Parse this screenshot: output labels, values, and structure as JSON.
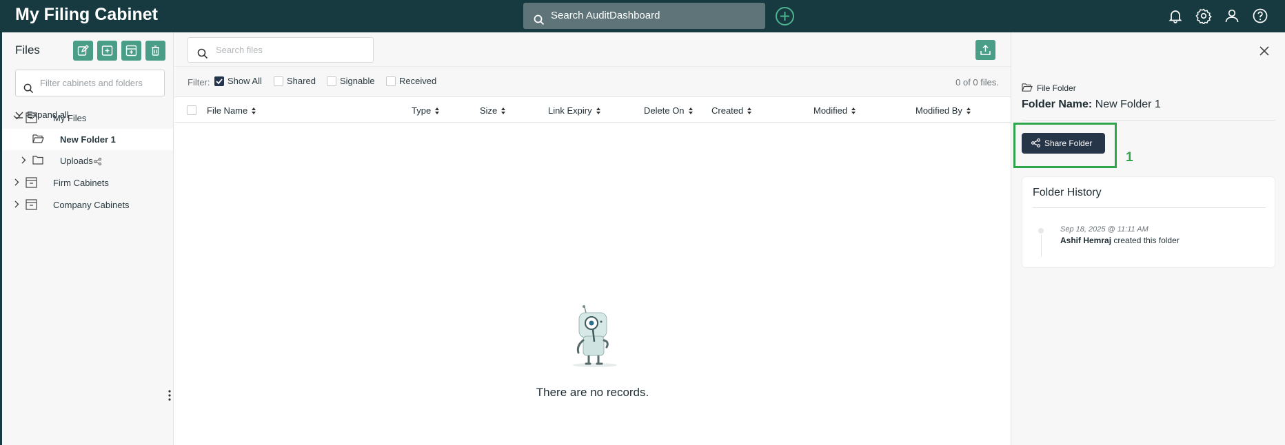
{
  "header": {
    "app_title": "My Filing Cabinet",
    "search_placeholder": "Search AuditDashboard",
    "icons": [
      "add-icon",
      "bell-icon",
      "gear-icon",
      "user-icon",
      "help-icon"
    ]
  },
  "sidebar": {
    "title": "Files",
    "action_icons": [
      "edit-icon",
      "new-folder-icon",
      "archive-icon",
      "trash-icon"
    ],
    "filter_placeholder": "Filter cabinets and folders",
    "expand_all_label": "Expand all",
    "tree": [
      {
        "label": "My Files",
        "level": 0,
        "expanded": true,
        "icon": "cabinet-icon"
      },
      {
        "label": "New Folder 1",
        "level": 1,
        "selected": true,
        "icon": "folder-open-icon"
      },
      {
        "label": "Uploads",
        "level": 1,
        "expanded": false,
        "icon": "folder-icon",
        "shared": true
      },
      {
        "label": "Firm Cabinets",
        "level": 0,
        "expanded": false,
        "icon": "cabinet-icon"
      },
      {
        "label": "Company Cabinets",
        "level": 0,
        "expanded": false,
        "icon": "cabinet-icon"
      }
    ]
  },
  "main": {
    "search_placeholder": "Search files",
    "filter_label": "Filter:",
    "filters": [
      {
        "label": "Show All",
        "checked": true
      },
      {
        "label": "Shared",
        "checked": false
      },
      {
        "label": "Signable",
        "checked": false
      },
      {
        "label": "Received",
        "checked": false
      }
    ],
    "file_count": "0 of 0 files.",
    "columns": [
      "File Name",
      "Type",
      "Size",
      "Link Expiry",
      "Delete On",
      "Created",
      "Modified",
      "Modified By"
    ],
    "empty_text": "There are no records."
  },
  "panel": {
    "kind_label": "File Folder",
    "name_label": "Folder Name:",
    "name_value": "New Folder 1",
    "share_button": "Share Folder",
    "callout_number": "1",
    "history_title": "Folder History",
    "history": [
      {
        "date": "Sep 18, 2025 @ 11:11 AM",
        "user": "Ashif Hemraj",
        "action": "created this folder"
      }
    ]
  },
  "colors": {
    "topbar": "#163a40",
    "accent": "#4a9d87",
    "primary_button": "#273548",
    "highlight": "#2ea54b"
  }
}
